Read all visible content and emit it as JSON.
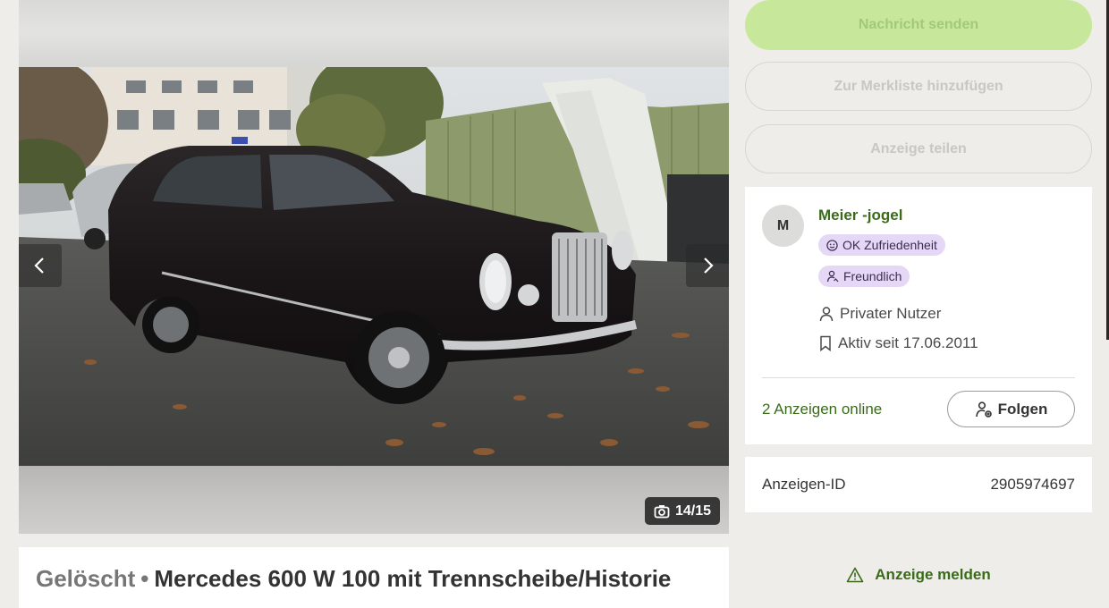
{
  "gallery": {
    "counter": "14/15",
    "prev_icon": "chevron-left-icon",
    "next_icon": "chevron-right-icon",
    "camera_icon": "camera-icon"
  },
  "title": {
    "status": "Gelöscht",
    "separator": "•",
    "text": "Mercedes 600 W 100 mit Trennscheibe/Historie"
  },
  "actions": {
    "send_message": "Nachricht senden",
    "add_watchlist": "Zur Merkliste hinzufügen",
    "share": "Anzeige teilen"
  },
  "seller": {
    "avatar_initial": "M",
    "name": "Meier -jogel",
    "badges": [
      {
        "label": "OK Zufriedenheit",
        "icon": "smile-icon"
      },
      {
        "label": "Freundlich",
        "icon": "friendly-user-icon"
      }
    ],
    "type": "Privater Nutzer",
    "active_since": "Aktiv seit 17.06.2011",
    "ads_online": "2 Anzeigen online",
    "follow_label": "Folgen"
  },
  "ad_id": {
    "label": "Anzeigen-ID",
    "value": "2905974697"
  },
  "report": {
    "label": "Anzeige melden",
    "icon": "warning-icon"
  },
  "colors": {
    "brand_green": "#3a6b1a",
    "primary_button": "#c7e89a",
    "badge_bg": "#e5d8f7",
    "page_bg": "#eeede9"
  }
}
